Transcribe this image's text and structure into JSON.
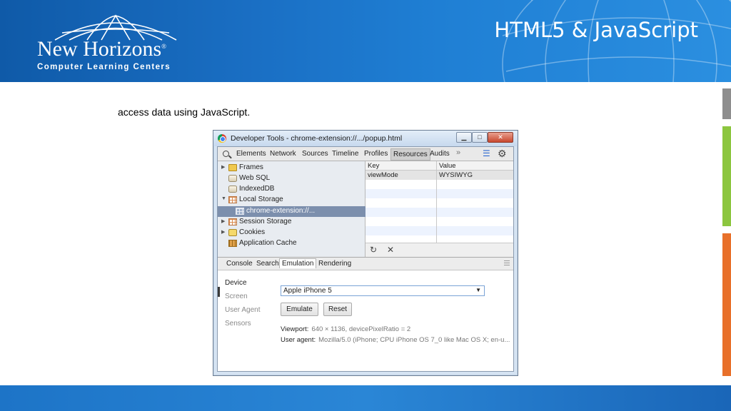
{
  "slide": {
    "title": "HTML5 & JavaScript",
    "caption": "access data using JavaScript.",
    "logo": {
      "name": "New Horizons",
      "registered": "®",
      "tagline": "Computer Learning Centers"
    },
    "colors": {
      "banner": "#1a6fc4",
      "accent_gray": "#8e8e8e",
      "accent_green": "#8cc63f",
      "accent_orange": "#e8702a"
    }
  },
  "devtools": {
    "window_title": "Developer Tools - chrome-extension://.../popup.html",
    "toolbar": {
      "tabs": [
        "Elements",
        "Network",
        "Sources",
        "Timeline",
        "Profiles",
        "Resources",
        "Audits"
      ],
      "active_tab": "Resources",
      "more": "»"
    },
    "sidebar": {
      "items": [
        {
          "label": "Frames",
          "icon": "folder-icon",
          "arrow": "▶"
        },
        {
          "label": "Web SQL",
          "icon": "database-icon",
          "arrow": ""
        },
        {
          "label": "IndexedDB",
          "icon": "database-icon",
          "arrow": ""
        },
        {
          "label": "Local Storage",
          "icon": "grid-icon",
          "arrow": "▼"
        },
        {
          "label": "chrome-extension://...",
          "icon": "grid-icon",
          "arrow": ""
        },
        {
          "label": "Session Storage",
          "icon": "grid-icon",
          "arrow": "▶"
        },
        {
          "label": "Cookies",
          "icon": "cookie-icon",
          "arrow": "▶"
        },
        {
          "label": "Application Cache",
          "icon": "cache-icon",
          "arrow": ""
        }
      ],
      "selected": "chrome-extension://..."
    },
    "storage_table": {
      "columns": [
        "Key",
        "Value"
      ],
      "rows": [
        {
          "key": "viewMode",
          "value": "WYSIWYG"
        }
      ]
    },
    "drawer": {
      "tabs": [
        "Console",
        "Search",
        "Emulation",
        "Rendering"
      ],
      "active_tab": "Emulation",
      "emulation_nav": [
        "Device",
        "Screen",
        "User Agent",
        "Sensors"
      ],
      "active_nav": "Device",
      "device_value": "Apple iPhone 5",
      "emulate_label": "Emulate",
      "reset_label": "Reset",
      "viewport_label": "Viewport:",
      "viewport_value": "640 × 1136, devicePixelRatio = 2",
      "user_agent_label": "User agent:",
      "user_agent_value": "Mozilla/5.0 (iPhone; CPU iPhone OS 7_0 like Mac OS X; en-u..."
    }
  }
}
